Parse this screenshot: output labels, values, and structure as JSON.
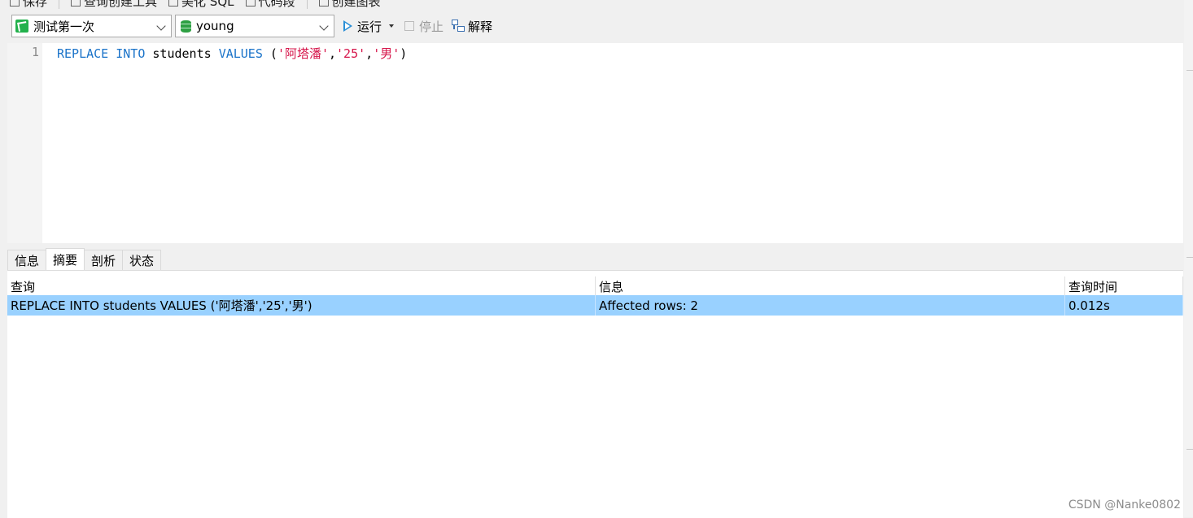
{
  "top_toolbar": {
    "items": [
      "保存",
      "查询创建工具",
      "美化 SQL",
      "代码段",
      "创建图表"
    ]
  },
  "connection": {
    "selected": "测试第一次"
  },
  "database": {
    "selected": "young"
  },
  "toolbar": {
    "run_label": "运行",
    "stop_label": "停止",
    "explain_label": "解释"
  },
  "editor": {
    "line_number": "1",
    "tokens": {
      "kw_replace": "REPLACE",
      "kw_into": "INTO",
      "table": "students",
      "kw_values": "VALUES",
      "open_paren": "(",
      "str1": "'阿塔潘'",
      "comma1": ",",
      "str2": "'25'",
      "comma2": ",",
      "str3": "'男'",
      "close_paren": ")"
    }
  },
  "result_tabs": [
    {
      "label": "信息"
    },
    {
      "label": "摘要"
    },
    {
      "label": "剖析"
    },
    {
      "label": "状态"
    }
  ],
  "result_table": {
    "columns": [
      "查询",
      "信息",
      "查询时间"
    ],
    "rows": [
      [
        "REPLACE INTO students VALUES ('阿塔潘','25','男')",
        "Affected rows: 2",
        "0.012s"
      ]
    ]
  },
  "watermark": "CSDN @Nanke0802"
}
